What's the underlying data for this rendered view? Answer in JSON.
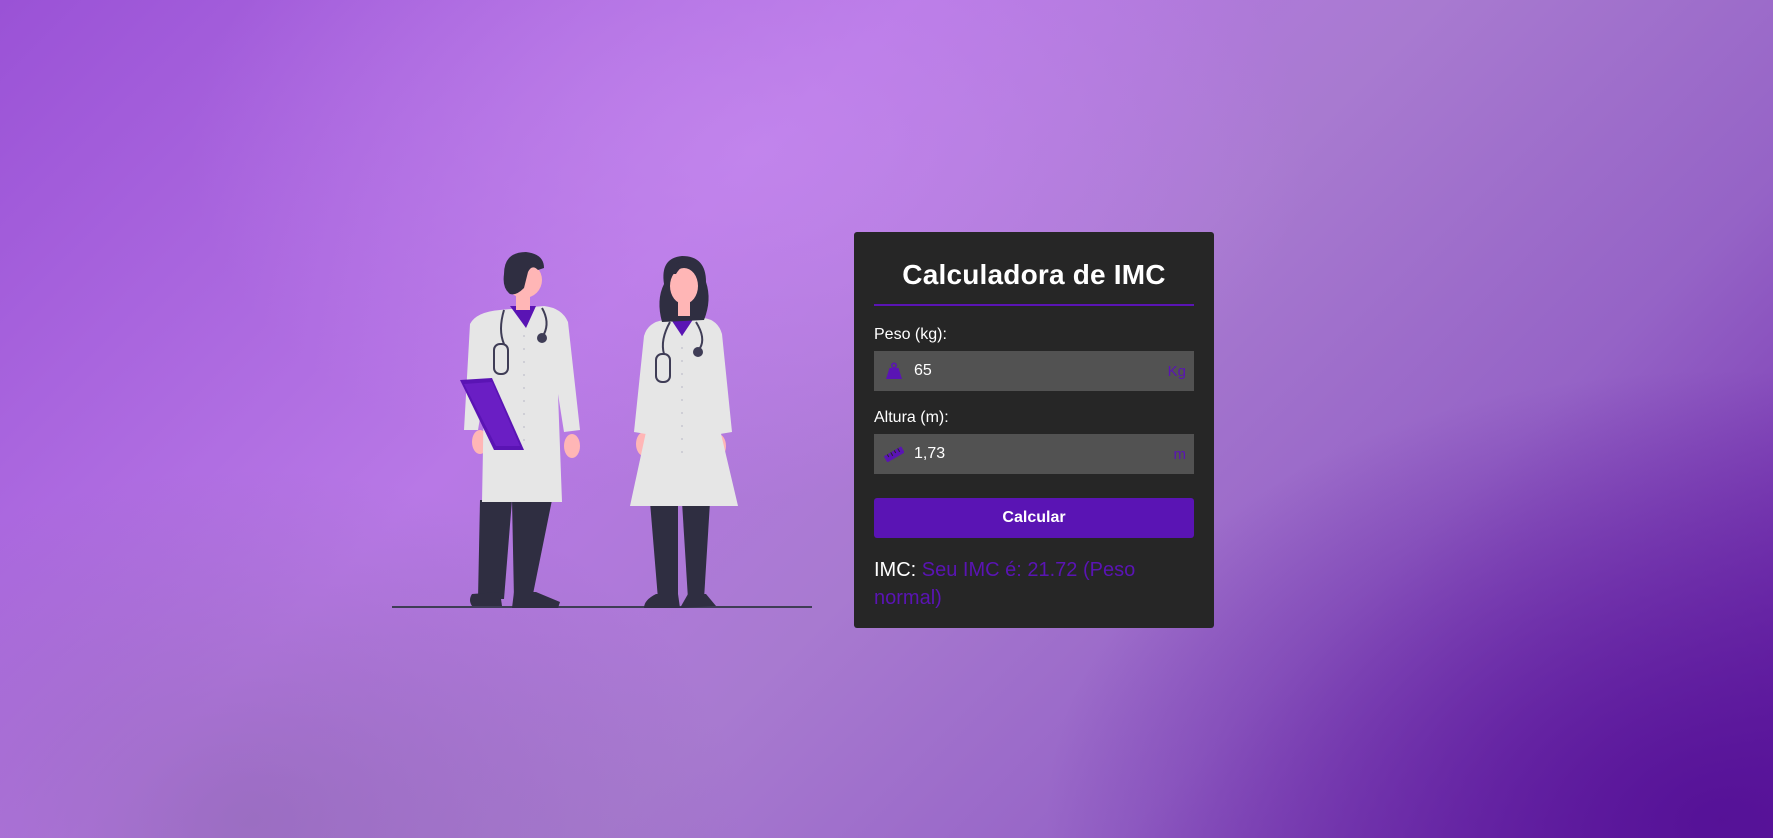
{
  "colors": {
    "accent": "#5a14b4",
    "card_bg": "#262626",
    "input_bg": "#525252",
    "text": "#ffffff"
  },
  "illustration": {
    "icon": "doctors-illustration"
  },
  "calculator": {
    "title": "Calculadora de IMC",
    "weight": {
      "label": "Peso (kg):",
      "value": "65",
      "unit": "Kg",
      "icon": "weight-icon"
    },
    "height": {
      "label": "Altura (m):",
      "value": "1,73",
      "unit": "m",
      "icon": "ruler-icon"
    },
    "button_label": "Calcular",
    "result": {
      "label": "IMC:",
      "value": "Seu IMC é: 21.72 (Peso normal)"
    }
  }
}
